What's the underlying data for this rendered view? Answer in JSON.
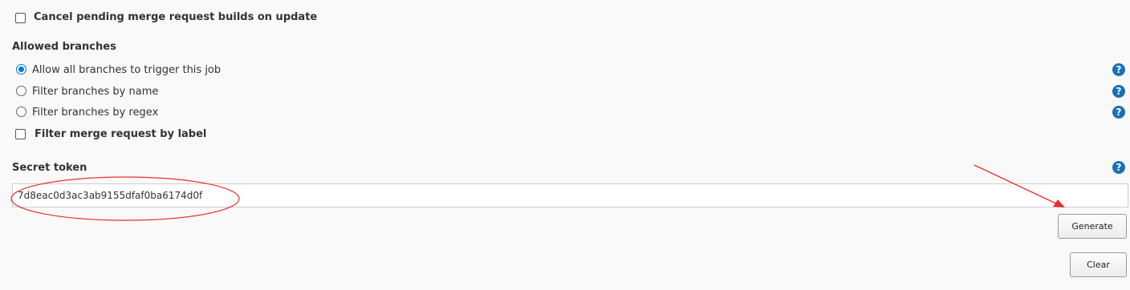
{
  "options": {
    "cancel_pending": {
      "label": "Cancel pending merge request builds on update",
      "checked": false
    }
  },
  "allowed_branches": {
    "heading": "Allowed branches",
    "radios": [
      {
        "label": "Allow all branches to trigger this job",
        "selected": true
      },
      {
        "label": "Filter branches by name",
        "selected": false
      },
      {
        "label": "Filter branches by regex",
        "selected": false
      }
    ],
    "filter_label": {
      "label": "Filter merge request by label",
      "checked": false
    }
  },
  "secret_token": {
    "heading": "Secret token",
    "value": "7d8eac0d3ac3ab9155dfaf0ba6174d0f"
  },
  "buttons": {
    "generate": "Generate",
    "clear": "Clear"
  },
  "help_glyph": "?",
  "colors": {
    "accent": "#0078d7",
    "help": "#1a6fb5",
    "annotation": "#e8302a"
  }
}
